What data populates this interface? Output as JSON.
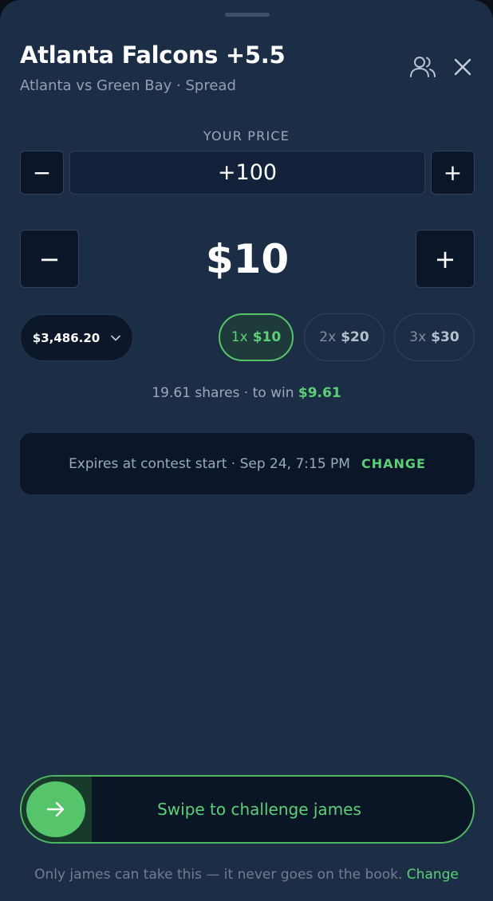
{
  "header": {
    "title": "Atlanta Falcons +5.5",
    "subtitle": "Atlanta vs Green Bay · Spread"
  },
  "icons": {
    "people": "people-icon",
    "close": "close-icon",
    "chevron": "chevron-down-icon",
    "arrow": "arrow-right-icon"
  },
  "price": {
    "label": "YOUR PRICE",
    "value": "+100",
    "minus": "−",
    "plus": "+"
  },
  "amount": {
    "value": "$10",
    "minus": "−",
    "plus": "+"
  },
  "balance": "$3,486.20",
  "multipliers": [
    {
      "x": "1x",
      "amount": "$10",
      "selected": true
    },
    {
      "x": "2x",
      "amount": "$20",
      "selected": false
    },
    {
      "x": "3x",
      "amount": "$30",
      "selected": false
    }
  ],
  "summary": {
    "shares": "19.61 shares",
    "separator": "·",
    "to_win_label": "to win",
    "to_win_value": "$9.61"
  },
  "expiry": {
    "text": "Expires at contest start · Sep 24, 7:15 PM",
    "change": "CHANGE"
  },
  "swipe": {
    "label": "Swipe to challenge james"
  },
  "footnote": {
    "text": "Only james can take this — it never goes on the book.",
    "link": "Change"
  },
  "colors": {
    "accent": "#55c46b",
    "sheet": "#1c2e46",
    "panel": "#0b1628"
  }
}
